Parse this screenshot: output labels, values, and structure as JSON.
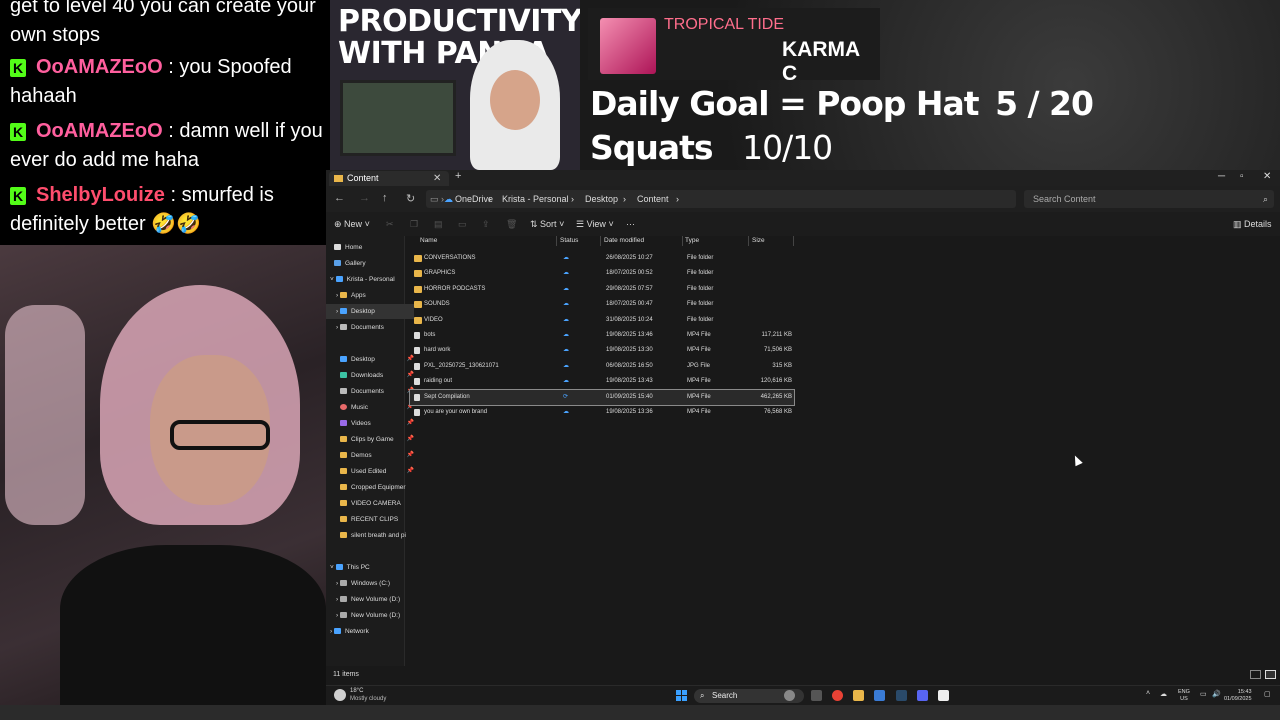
{
  "chat": {
    "lines": [
      {
        "user": "",
        "message": "get to level 40 you can create your own stops"
      },
      {
        "user": "OoAMAZEoO",
        "message": ": you Spoofed hahaah"
      },
      {
        "user": "OoAMAZEoO",
        "message": ": damn well if you ever do add me haha"
      },
      {
        "user": "ShelbyLouize",
        "message": ": smurfed is definitely better 🤣🤣"
      }
    ],
    "badge": "K",
    "colors": {
      "badge": "#53fc18",
      "user_pink": "#ff5f9e",
      "user_red": "#ff4d6d"
    }
  },
  "banner": {
    "title_line1": "PRODUCTIVITY",
    "title_line2": "WITH PANDA"
  },
  "music": {
    "title": "TROPICAL TIDE",
    "artist": "KARMA C"
  },
  "goal": {
    "label": "Daily Goal = Poop Hat",
    "progress": "5 / 20"
  },
  "squats": {
    "label": "Squats",
    "value": "10/10"
  },
  "explorer": {
    "tab_title": "Content",
    "breadcrumb": [
      "OneDrive",
      "Krista - Personal",
      "Desktop",
      "Content"
    ],
    "search_placeholder": "Search Content",
    "toolbar": {
      "new": "New",
      "sort": "Sort",
      "view": "View",
      "more": "···",
      "details": "Details"
    },
    "nav": {
      "home": "Home",
      "gallery": "Gallery",
      "krista": "Krista - Personal",
      "apps": "Apps",
      "desktop_sub": "Desktop",
      "documents_sub": "Documents",
      "quick": [
        "Desktop",
        "Downloads",
        "Documents",
        "Music",
        "Videos",
        "Clips by Game",
        "Demos",
        "Used Edited",
        "Cropped Equipmer",
        "VIDEO CAMERA",
        "RECENT CLIPS",
        "silent breath and pi"
      ],
      "this_pc": "This PC",
      "drives": [
        "Windows (C:)",
        "New Volume (D:)",
        "New Volume (D:)"
      ],
      "network": "Network"
    },
    "columns": {
      "name": "Name",
      "status": "Status",
      "date": "Date modified",
      "type": "Type",
      "size": "Size"
    },
    "files": [
      {
        "name": "CONVERSATIONS",
        "status": "☁",
        "date": "26/08/2025 10:27",
        "type": "File folder",
        "size": "",
        "kind": "folder"
      },
      {
        "name": "GRAPHICS",
        "status": "☁",
        "date": "18/07/2025 00:52",
        "type": "File folder",
        "size": "",
        "kind": "folder"
      },
      {
        "name": "HORROR PODCASTS",
        "status": "☁",
        "date": "29/08/2025 07:57",
        "type": "File folder",
        "size": "",
        "kind": "folder"
      },
      {
        "name": "SOUNDS",
        "status": "☁",
        "date": "18/07/2025 00:47",
        "type": "File folder",
        "size": "",
        "kind": "folder"
      },
      {
        "name": "VIDEO",
        "status": "☁",
        "date": "31/08/2025 10:24",
        "type": "File folder",
        "size": "",
        "kind": "folder"
      },
      {
        "name": "bots",
        "status": "☁",
        "date": "19/08/2025 13:46",
        "type": "MP4 File",
        "size": "117,211 KB",
        "kind": "file"
      },
      {
        "name": "hard work",
        "status": "☁",
        "date": "19/08/2025 13:30",
        "type": "MP4 File",
        "size": "71,506 KB",
        "kind": "file"
      },
      {
        "name": "PXL_20250725_130621071",
        "status": "☁",
        "date": "06/08/2025 16:50",
        "type": "JPG File",
        "size": "315 KB",
        "kind": "file"
      },
      {
        "name": "raiding out",
        "status": "☁",
        "date": "19/08/2025 13:43",
        "type": "MP4 File",
        "size": "120,616 KB",
        "kind": "file"
      },
      {
        "name": "Sept Compilation",
        "status": "⟳",
        "date": "01/09/2025 15:40",
        "type": "MP4 File",
        "size": "462,265 KB",
        "kind": "file"
      },
      {
        "name": "you are your own brand",
        "status": "☁",
        "date": "19/08/2025 13:36",
        "type": "MP4 File",
        "size": "76,568 KB",
        "kind": "file"
      }
    ],
    "selected_index": 9,
    "item_count": "11 items"
  },
  "taskbar": {
    "weather_temp": "18°C",
    "weather_desc": "Mostly cloudy",
    "search": "Search",
    "lang_line1": "ENG",
    "lang_line2": "US",
    "time": "15:43",
    "date": "01/09/2025"
  }
}
